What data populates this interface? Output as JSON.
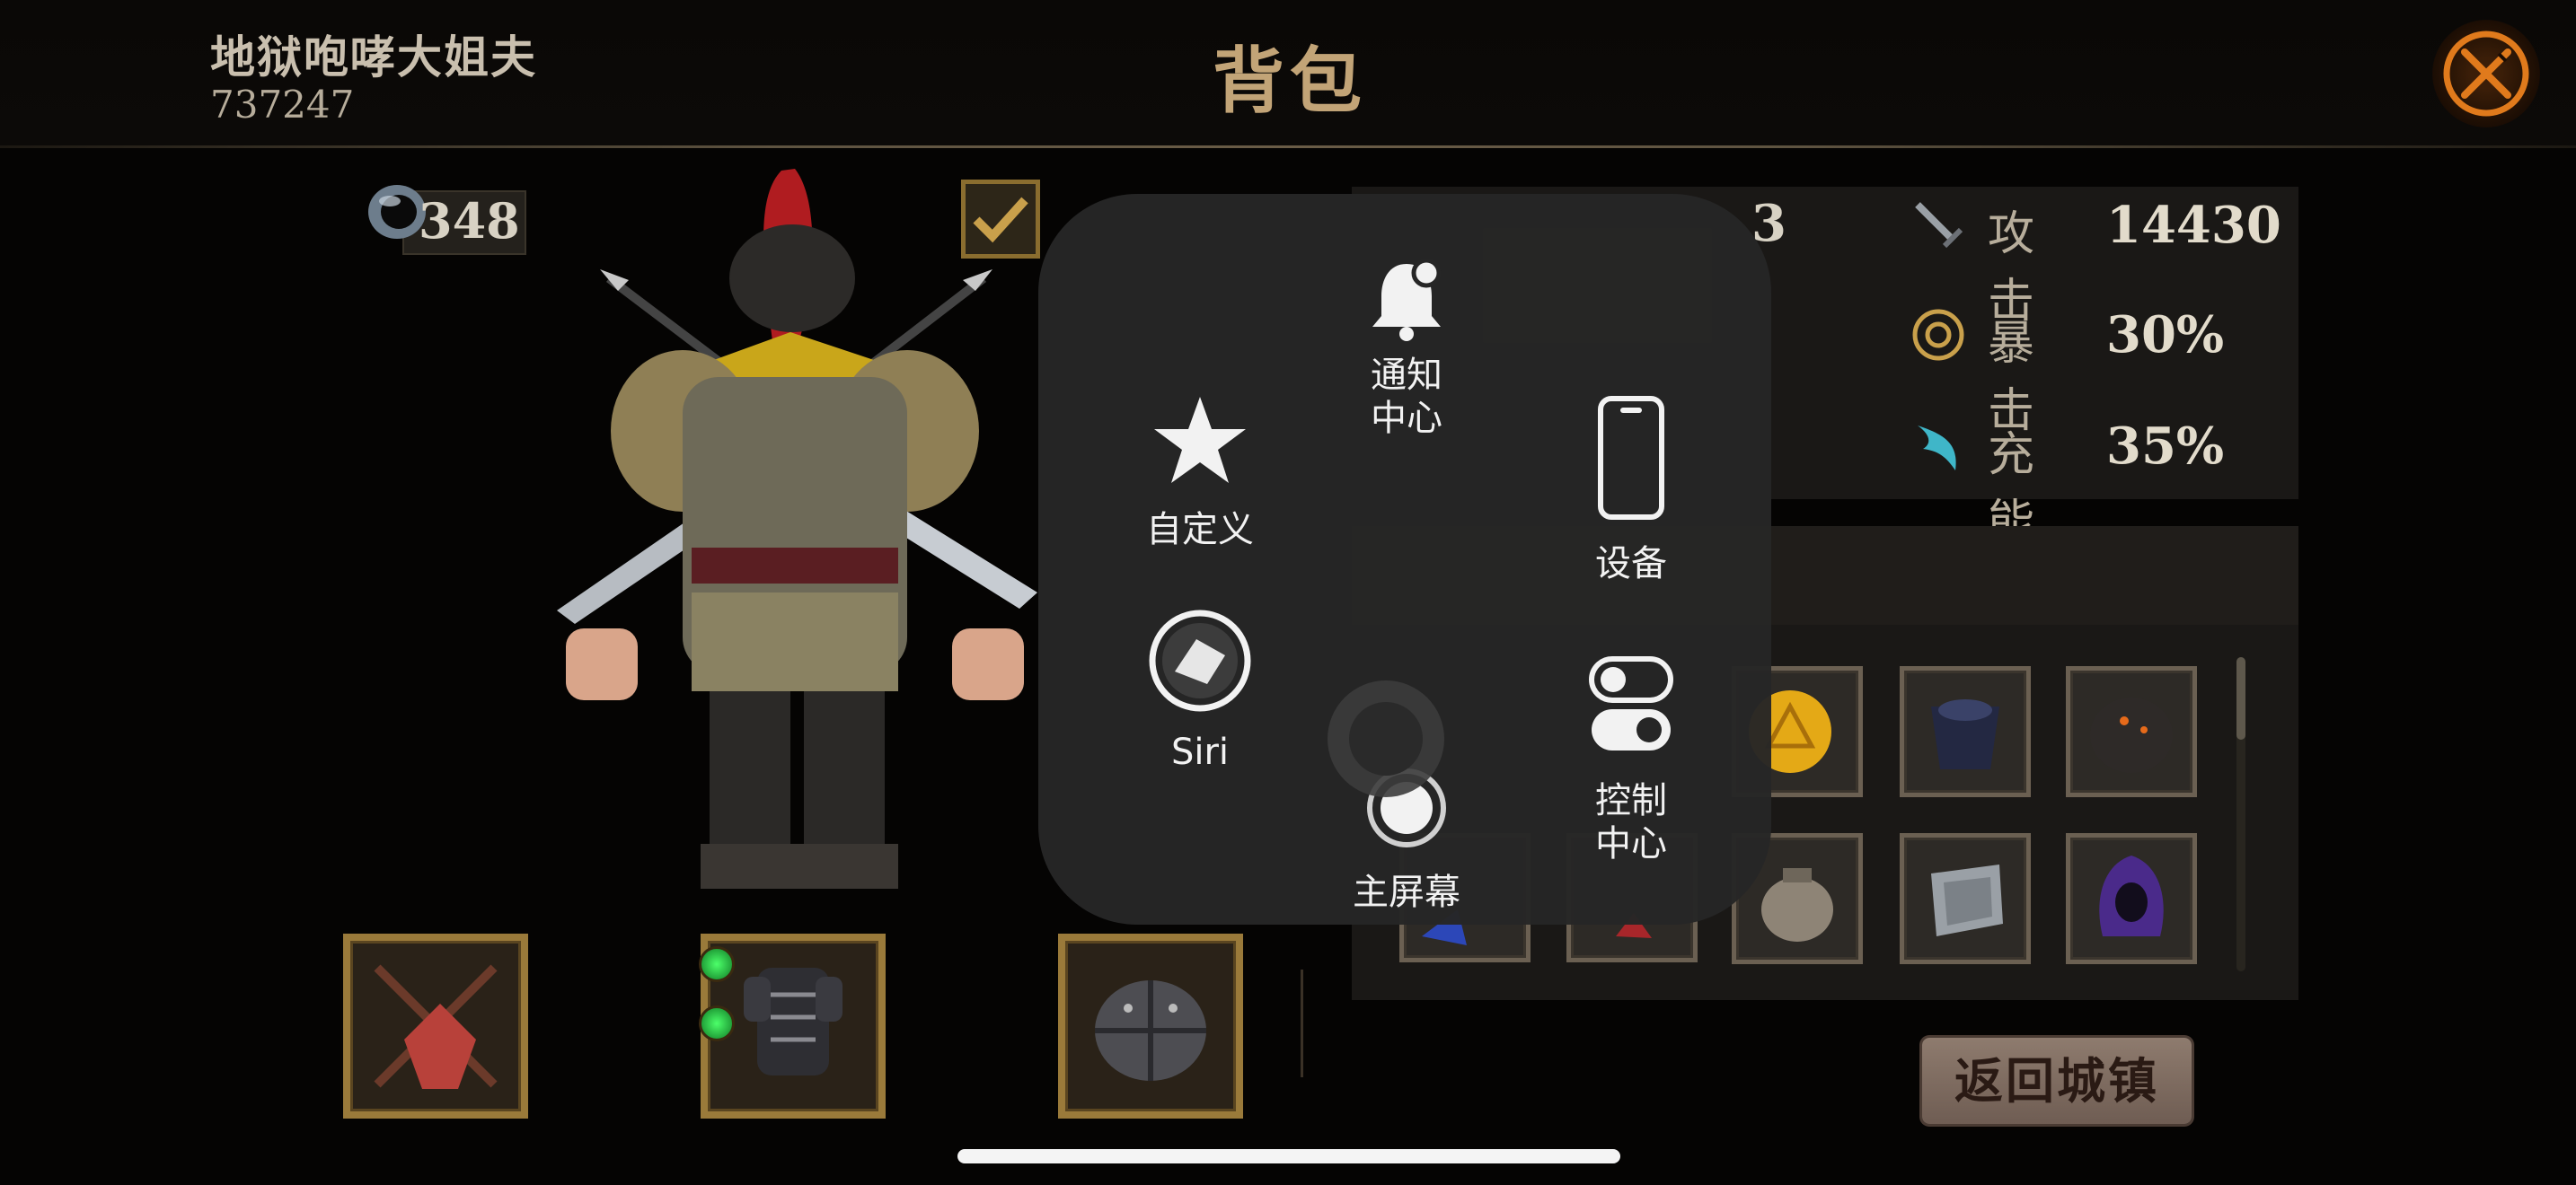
{
  "header": {
    "player_name": "地狱咆哮大姐夫",
    "player_id": "737247",
    "title": "背包",
    "close_icon": "crossed-swords-close-icon"
  },
  "currency": {
    "icon": "ring-icon",
    "value": "348"
  },
  "stats": {
    "partial_value": "3",
    "attack": {
      "icon": "sword-icon",
      "label": "攻击",
      "value": "14430"
    },
    "crit": {
      "icon": "crit-target-icon",
      "label": "暴击",
      "value": "30%"
    },
    "energy": {
      "icon": "energy-wing-icon",
      "label": "充能",
      "value": "35%"
    }
  },
  "equipment_slots": [
    {
      "name": "weapon-slot",
      "icon": "crossed-axes-icon",
      "gems": 0
    },
    {
      "name": "armor-slot",
      "icon": "chest-armor-icon",
      "gems": 2
    },
    {
      "name": "helmet-slot",
      "icon": "iron-helmet-icon",
      "gems": 0
    }
  ],
  "inventory": {
    "row1": [
      "gold-coin-icon",
      "dark-cape-icon",
      "volcanic-helmet-icon"
    ],
    "row2": [
      "item-partial-icon",
      "item-partial-icon",
      "pouch-icon",
      "stone-shield-icon",
      "purple-hood-icon"
    ]
  },
  "return_button": "返回城镇",
  "assistive_touch": {
    "notification": "通知\n中心",
    "customize": "自定义",
    "device": "设备",
    "siri": "Siri",
    "control_center": "控制\n中心",
    "home": "主屏幕"
  },
  "colors": {
    "accent_gold": "#c2a477",
    "frame_gold": "#9a7a3a",
    "overlay": "#262626"
  }
}
